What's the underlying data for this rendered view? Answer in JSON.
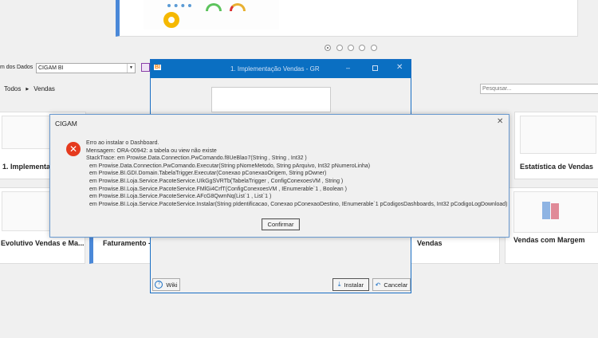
{
  "banner": {
    "dots": 5,
    "active_dot": 0
  },
  "toolbar": {
    "source_label": "m dos Dados",
    "source_value": "CIGAM BI"
  },
  "breadcrumb": {
    "root": "Todos",
    "current": "Vendas"
  },
  "search": {
    "placeholder": "Pesquisar..."
  },
  "cards": [
    {
      "title": "1. Implementação"
    },
    {
      "title": "Estatística de Vendas"
    },
    {
      "title": "Evolutivo Vendas e Ma..."
    },
    {
      "title": "Faturamento -"
    },
    {
      "title": "Vendas"
    },
    {
      "title": "Vendas com Margem"
    }
  ],
  "preview_dialog": {
    "logo": "BI",
    "title": "1. Implementação  Vendas - GR",
    "wiki": "Wiki",
    "install": "Instalar",
    "cancel": "Cancelar"
  },
  "error_dialog": {
    "title": "CIGAM",
    "lines": [
      "Erro ao instalar o Dashboard.",
      "Mensagem: ORA-00942: a tabela ou view não existe",
      "StackTrace:    em Prowise.Data.Connection.PwComando.f8UeBlao7(String  , String  , Int32  )",
      "   em Prowise.Data.Connection.PwComando.Executar(String pNomeMetodo, String pArquivo, Int32 pNumeroLinha)",
      "   em Prowise.BI.GDI.Domain.TabelaTrigger.Executar(Conexao pConexaoOrigem, String pOwner)",
      "   em Prowise.BI.Loja.Service.PacoteService.UIkGgSVRTb(TabelaTrigger  , ConfigConexoesVM  , String  )",
      "   em Prowise.BI.Loja.Service.PacoteService.FMlGi4CrfT(ConfigConexoesVM  , IEnumerable`1  , Boolean  )",
      "   em Prowise.BI.Loja.Service.PacoteService.AFcG8QwmNq(List`1  , List`1  )",
      "   em Prowise.BI.Loja.Service.PacoteService.Instalar(String pIdentificacao, Conexao pConexaoDestino, IEnumerable`1 pCodigosDashboards, Int32 pCodigoLogDownload)"
    ],
    "confirm": "Confirmar"
  }
}
